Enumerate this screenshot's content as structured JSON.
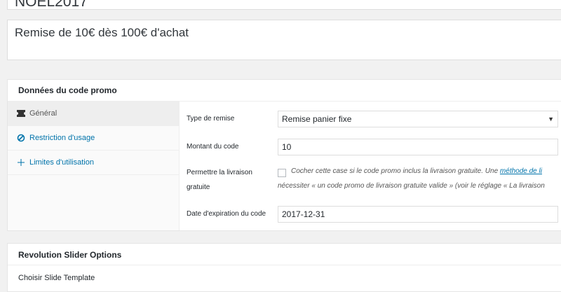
{
  "coupon": {
    "code": "NOEL2017",
    "description": "Remise de 10€ dès 100€ d'achat"
  },
  "coupon_data": {
    "title": "Données du code promo",
    "tabs": [
      {
        "label": "Général",
        "icon": "ticket-icon"
      },
      {
        "label": "Restriction d'usage",
        "icon": "forbidden-icon"
      },
      {
        "label": "Limites d'utilisation",
        "icon": "plus-icon"
      }
    ],
    "fields": {
      "discount_type_label": "Type de remise",
      "discount_type_value": "Remise panier fixe",
      "amount_label": "Montant du code",
      "amount_value": "10",
      "free_shipping_label_1": "Permettre la livraison",
      "free_shipping_label_2": "gratuite",
      "free_shipping_desc_1": "Cocher cette case si le code promo inclus la livraison gratuite. Une ",
      "free_shipping_link": "méthode de li",
      "free_shipping_desc_2": "nécessiter « un code promo de livraison gratuite valide » (voir le réglage « La livraison",
      "expiry_label": "Date d'expiration du code",
      "expiry_value": "2017-12-31"
    }
  },
  "slider_panel": {
    "title": "Revolution Slider Options",
    "choose_template": "Choisir Slide Template"
  },
  "colors": {
    "link": "#0073aa",
    "background": "#f1f1f1"
  }
}
